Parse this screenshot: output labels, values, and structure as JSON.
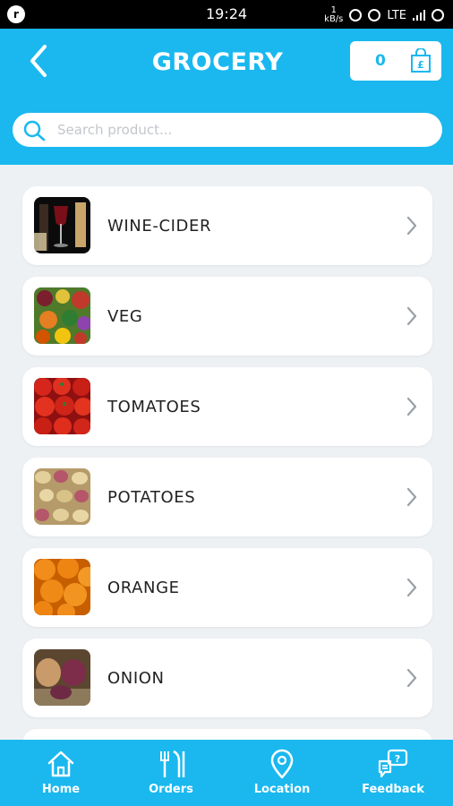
{
  "status_bar": {
    "time": "19:24",
    "network_speed_value": "1",
    "network_speed_unit": "kB/s",
    "network_type": "LTE"
  },
  "header": {
    "title": "GROCERY",
    "cart_count": "0",
    "cart_currency": "£",
    "search_placeholder": "Search product..."
  },
  "categories": [
    {
      "label": "WINE-CIDER",
      "image": "wine-image"
    },
    {
      "label": "VEG",
      "image": "vegetables-image"
    },
    {
      "label": "TOMATOES",
      "image": "tomatoes-image"
    },
    {
      "label": "POTATOES",
      "image": "potatoes-image"
    },
    {
      "label": "ORANGE",
      "image": "oranges-image"
    },
    {
      "label": "ONION",
      "image": "onions-image"
    }
  ],
  "bottom_nav": [
    {
      "label": "Home",
      "icon": "home-icon"
    },
    {
      "label": "Orders",
      "icon": "cutlery-icon"
    },
    {
      "label": "Location",
      "icon": "location-pin-icon"
    },
    {
      "label": "Feedback",
      "icon": "feedback-icon"
    }
  ],
  "colors": {
    "primary": "#1ab8ef",
    "background": "#eef1f4",
    "card": "#ffffff",
    "text": "#222222"
  }
}
